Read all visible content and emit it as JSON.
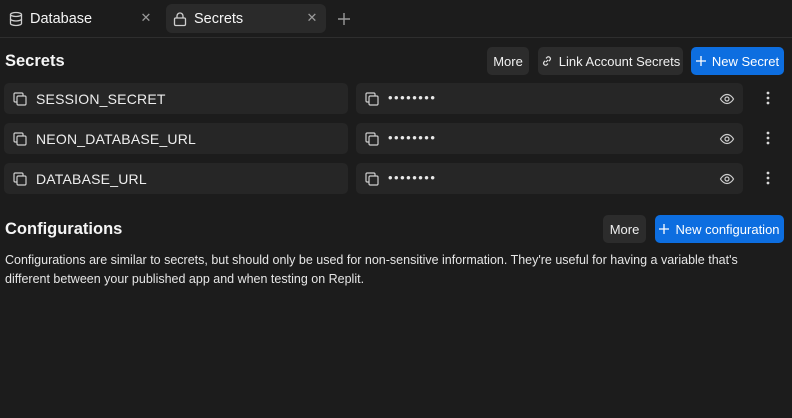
{
  "tabs": [
    {
      "label": "Database",
      "icon": "database-icon"
    },
    {
      "label": "Secrets",
      "icon": "lock-icon"
    }
  ],
  "secrets": {
    "title": "Secrets",
    "more_label": "More",
    "link_label": "Link Account Secrets",
    "new_label": "New Secret",
    "rows": [
      {
        "key": "SESSION_SECRET",
        "value": "••••••••"
      },
      {
        "key": "NEON_DATABASE_URL",
        "value": "••••••••"
      },
      {
        "key": "DATABASE_URL",
        "value": "••••••••"
      }
    ]
  },
  "configurations": {
    "title": "Configurations",
    "more_label": "More",
    "new_label": "New configuration",
    "description": "Configurations are similar to secrets, but should only be used for non-sensitive information. They're useful for having a variable that's different between your published app and when testing on Replit."
  },
  "colors": {
    "background": "#1c1c1c",
    "row": "#262626",
    "primary": "#0d6ee0",
    "text": "#f0f0f0"
  }
}
